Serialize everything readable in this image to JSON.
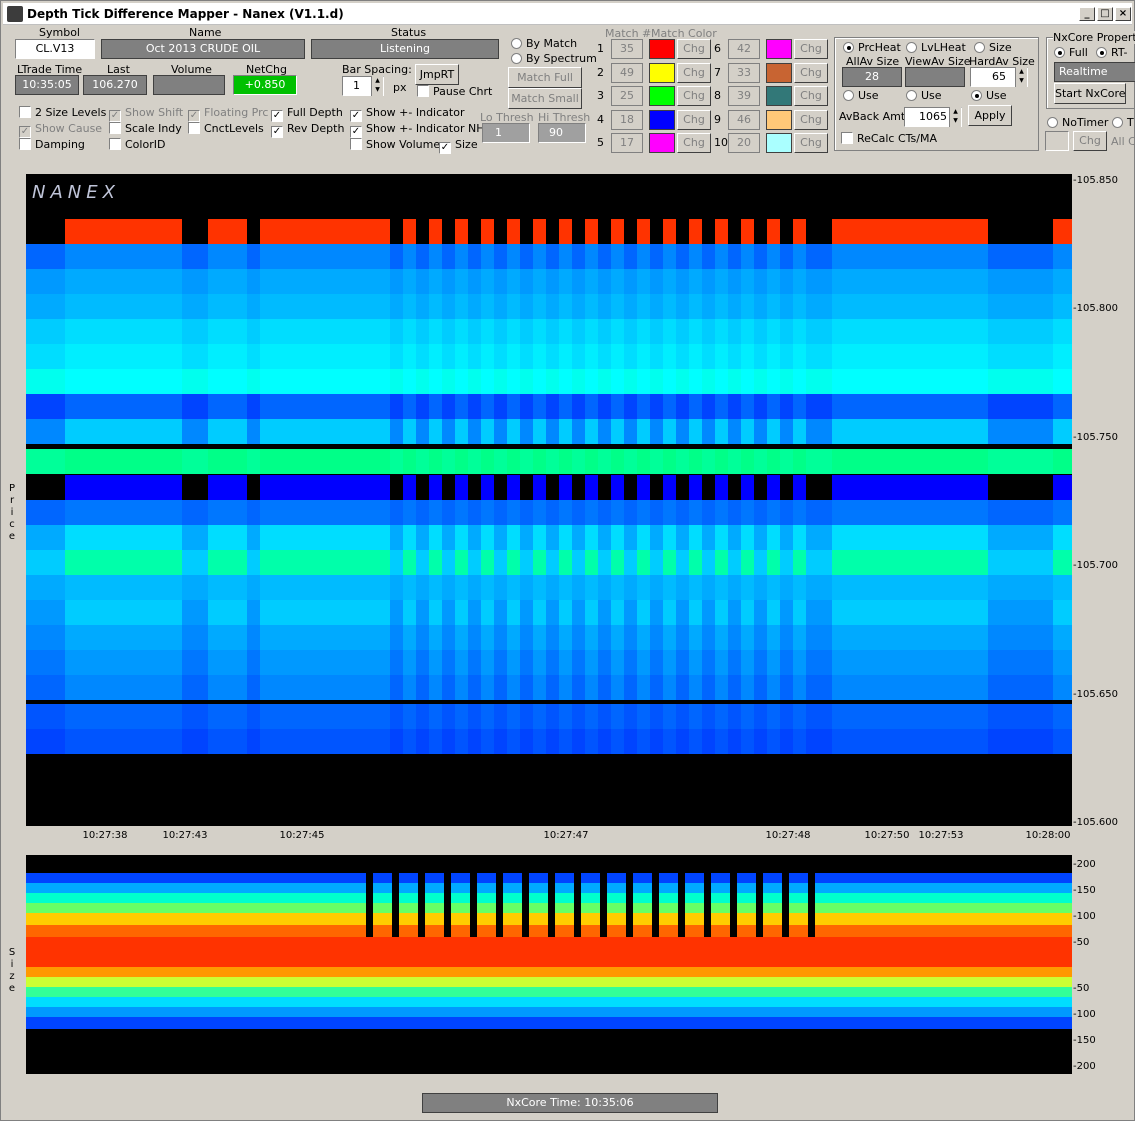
{
  "window": {
    "title": "Depth Tick Difference Mapper - Nanex (V1.1.d)"
  },
  "header": {
    "symbol_label": "Symbol",
    "symbol": "CL.V13",
    "name_label": "Name",
    "name": "Oct 2013 CRUDE OIL",
    "status_label": "Status",
    "status": "Listening",
    "ltrade_label": "LTrade Time",
    "ltrade": "10:35:05",
    "last_label": "Last",
    "last": "106.270",
    "volume_label": "Volume",
    "volume": "",
    "netchg_label": "NetChg",
    "netchg": "+0.850"
  },
  "options": {
    "c1": "2 Size Levels",
    "c2": "Show Cause",
    "c3": "Damping",
    "c4": "Show Shift",
    "c5": "Scale Indy",
    "c6": "ColorID",
    "c7": "Floating Prc",
    "c8": "CnctLevels",
    "c9": "Full Depth",
    "c10": "Rev Depth",
    "c11": "Show +- Indicator",
    "c12": "Show +- Indicator NH",
    "c13": "Show Volume",
    "c14": "Size"
  },
  "bar_spacing": {
    "label": "Bar Spacing:",
    "value": "1",
    "unit": "px",
    "jmprt": "JmpRT",
    "pause": "Pause Chrt"
  },
  "thresh": {
    "lo_label": "Lo Thresh",
    "lo": "1",
    "hi_label": "Hi Thresh",
    "hi": "90"
  },
  "match": {
    "by_match": "By Match",
    "by_spectrum": "By Spectrum",
    "match_full": "Match Full",
    "match_small": "Match Small",
    "num_label": "Match #",
    "color_label": "Match Color",
    "chg": "Chg",
    "rows": [
      {
        "idx": "1",
        "val": "35",
        "color": "#ff0000"
      },
      {
        "idx": "2",
        "val": "49",
        "color": "#ffff00"
      },
      {
        "idx": "3",
        "val": "25",
        "color": "#00ff00"
      },
      {
        "idx": "4",
        "val": "18",
        "color": "#0000ff"
      },
      {
        "idx": "5",
        "val": "17",
        "color": "#ff00ff"
      },
      {
        "idx": "6",
        "val": "42",
        "color": "#ff00ff"
      },
      {
        "idx": "7",
        "val": "33",
        "color": "#c86432"
      },
      {
        "idx": "8",
        "val": "39",
        "color": "#327878"
      },
      {
        "idx": "9",
        "val": "46",
        "color": "#ffc878"
      },
      {
        "idx": "10",
        "val": "20",
        "color": "#aaffff"
      }
    ]
  },
  "heat": {
    "prcheat": "PrcHeat",
    "lvlheat": "LvLHeat",
    "size": "Size",
    "allav_label": "AllAv Size",
    "allav": "28",
    "viewav_label": "ViewAv Size",
    "viewav": "",
    "hardav_label": "HardAv Size",
    "hardav": "65",
    "use": "Use",
    "avback_label": "AvBack Amt:",
    "avback": "1065",
    "apply": "Apply",
    "recalc": "ReCalc CTs/MA"
  },
  "nxcore": {
    "title": "NxCore Properties",
    "full": "Full",
    "rt": "RT-",
    "mode": "Realtime",
    "start": "Start NxCore",
    "notimer": "NoTimer",
    "t": "T",
    "chg": "Chg",
    "all": "All C",
    "time_label": "NxCore Time: 10:35:06"
  },
  "chart_data": [
    {
      "type": "heatmap",
      "name": "price",
      "watermark": "NANEX",
      "ylabel": "Price",
      "ylim": [
        105.6,
        105.85
      ],
      "yticks": [
        "-105.850",
        "-105.800",
        "-105.750",
        "-105.700",
        "-105.650",
        "-105.600"
      ],
      "xticks": [
        "10:27:38",
        "10:27:43",
        "10:27:45",
        "10:27:47",
        "10:27:48",
        "10:27:50",
        "10:27:53",
        "10:28:00"
      ]
    },
    {
      "type": "area",
      "name": "size",
      "ylabel": "Size",
      "yticks": [
        "-200",
        "-150",
        "-100",
        "-50",
        "-50",
        "-100",
        "-150",
        "-200"
      ]
    }
  ]
}
